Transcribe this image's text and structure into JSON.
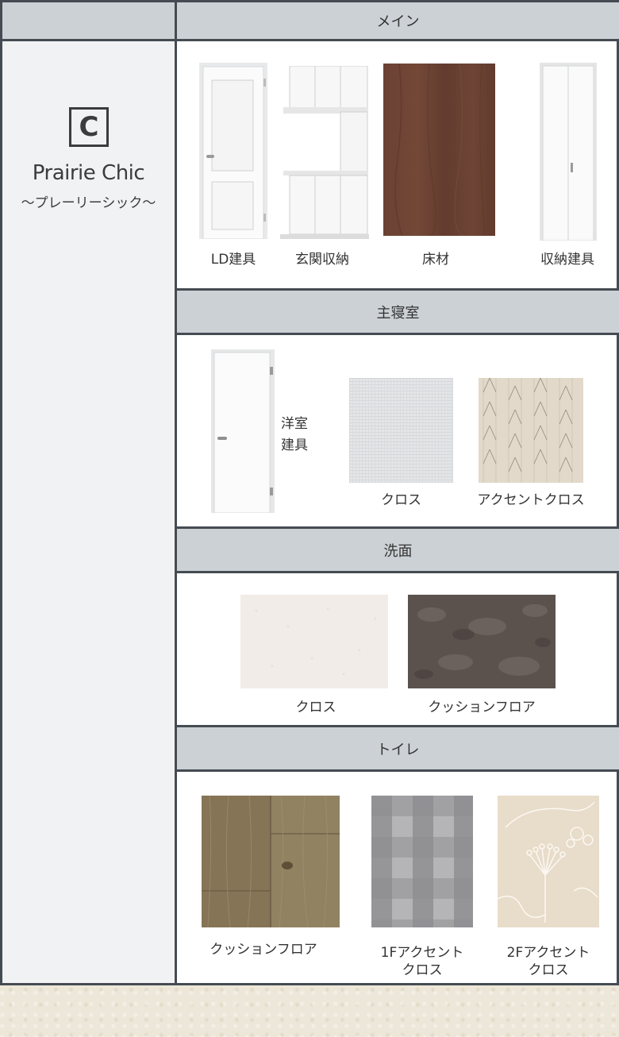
{
  "plan": {
    "badge": "C",
    "name": "Prairie Chic",
    "subtitle": "〜プレーリーシック〜"
  },
  "sections": [
    {
      "title": "メイン",
      "items": [
        {
          "label": "LD建具",
          "icon": "white-panel-door"
        },
        {
          "label": "玄関収納",
          "icon": "white-shoe-cabinet"
        },
        {
          "label": "床材",
          "icon": "walnut-wood-flooring"
        },
        {
          "label": "収納建具",
          "icon": "white-folding-door"
        }
      ]
    },
    {
      "title": "主寝室",
      "items": [
        {
          "label_line1": "洋室",
          "label_line2": "建具",
          "icon": "white-flush-door"
        },
        {
          "label": "クロス",
          "icon": "light-gray-wallpaper"
        },
        {
          "label": "アクセントクロス",
          "icon": "herringbone-wallpaper"
        }
      ]
    },
    {
      "title": "洗面",
      "items": [
        {
          "label": "クロス",
          "icon": "off-white-wallpaper"
        },
        {
          "label": "クッションフロア",
          "icon": "dark-stone-cushion-floor"
        }
      ]
    },
    {
      "title": "トイレ",
      "items": [
        {
          "label": "クッションフロア",
          "icon": "weathered-wood-cushion-floor"
        },
        {
          "label_line1": "1Fアクセント",
          "label_line2": "クロス",
          "icon": "gray-check-wallpaper"
        },
        {
          "label_line1": "2Fアクセント",
          "label_line2": "クロス",
          "icon": "botanical-wallpaper"
        }
      ]
    }
  ],
  "colors": {
    "border": "#454b52",
    "header_bg": "#ccd1d5",
    "left_bg": "#f0f2f4",
    "floor_walnut": "#6b4234"
  }
}
